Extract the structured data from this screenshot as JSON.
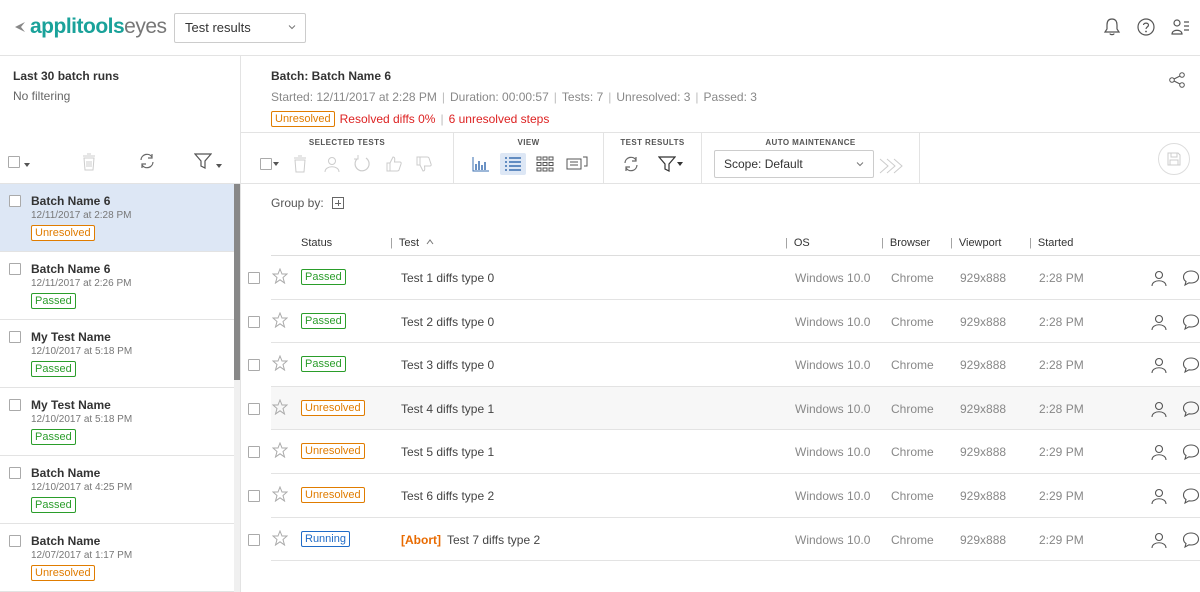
{
  "app": {
    "logo_brand": "applitools",
    "logo_suffix": "eyes",
    "view_select": "Test results"
  },
  "sidebar": {
    "title": "Last 30 batch runs",
    "filter_text": "No filtering",
    "batches": [
      {
        "name": "Batch Name 6",
        "date": "12/11/2017 at 2:28 PM",
        "status": "Unresolved",
        "status_key": "unresolved",
        "selected": true
      },
      {
        "name": "Batch Name 6",
        "date": "12/11/2017 at 2:26 PM",
        "status": "Passed",
        "status_key": "passed",
        "selected": false
      },
      {
        "name": "My Test Name",
        "date": "12/10/2017 at 5:18 PM",
        "status": "Passed",
        "status_key": "passed",
        "selected": false
      },
      {
        "name": "My Test Name",
        "date": "12/10/2017 at 5:18 PM",
        "status": "Passed",
        "status_key": "passed",
        "selected": false
      },
      {
        "name": "Batch Name",
        "date": "12/10/2017 at 4:25 PM",
        "status": "Passed",
        "status_key": "passed",
        "selected": false
      },
      {
        "name": "Batch Name",
        "date": "12/07/2017 at 1:17 PM",
        "status": "Unresolved",
        "status_key": "unresolved",
        "selected": false
      }
    ]
  },
  "batch": {
    "title": "Batch: Batch Name 6",
    "started": "Started: 12/11/2017 at 2:28 PM",
    "duration": "Duration: 00:00:57",
    "tests": "Tests: 7",
    "unresolved": "Unresolved: 3",
    "passed": "Passed: 3",
    "status_badge": "Unresolved",
    "resolved_diffs": "Resolved diffs 0%",
    "unresolved_steps": "6 unresolved steps"
  },
  "toolbar": {
    "selected_tests_label": "SELECTED TESTS",
    "view_label": "VIEW",
    "test_results_label": "TEST RESULTS",
    "auto_maintenance_label": "AUTO MAINTENANCE",
    "scope_value": "Scope: Default"
  },
  "groupby_label": "Group by:",
  "table": {
    "headers": {
      "status": "Status",
      "test": "Test",
      "os": "OS",
      "browser": "Browser",
      "viewport": "Viewport",
      "started": "Started"
    },
    "rows": [
      {
        "status": "Passed",
        "status_key": "passed",
        "abort": "",
        "test": "Test 1 diffs type 0",
        "os": "Windows 10.0",
        "browser": "Chrome",
        "viewport": "929x888",
        "started": "2:28 PM"
      },
      {
        "status": "Passed",
        "status_key": "passed",
        "abort": "",
        "test": "Test 2 diffs type 0",
        "os": "Windows 10.0",
        "browser": "Chrome",
        "viewport": "929x888",
        "started": "2:28 PM"
      },
      {
        "status": "Passed",
        "status_key": "passed",
        "abort": "",
        "test": "Test 3 diffs type 0",
        "os": "Windows 10.0",
        "browser": "Chrome",
        "viewport": "929x888",
        "started": "2:28 PM"
      },
      {
        "status": "Unresolved",
        "status_key": "unresolved",
        "abort": "",
        "test": "Test 4 diffs type 1",
        "os": "Windows 10.0",
        "browser": "Chrome",
        "viewport": "929x888",
        "started": "2:28 PM"
      },
      {
        "status": "Unresolved",
        "status_key": "unresolved",
        "abort": "",
        "test": "Test 5 diffs type 1",
        "os": "Windows 10.0",
        "browser": "Chrome",
        "viewport": "929x888",
        "started": "2:29 PM"
      },
      {
        "status": "Unresolved",
        "status_key": "unresolved",
        "abort": "",
        "test": "Test 6 diffs type 2",
        "os": "Windows 10.0",
        "browser": "Chrome",
        "viewport": "929x888",
        "started": "2:29 PM"
      },
      {
        "status": "Running",
        "status_key": "running",
        "abort": "[Abort]",
        "test": "Test 7 diffs type 2",
        "os": "Windows 10.0",
        "browser": "Chrome",
        "viewport": "929x888",
        "started": "2:29 PM"
      }
    ]
  },
  "colors": {
    "brand": "#1aa29a",
    "passed": "#2a9d2a",
    "unresolved": "#e07c00",
    "running": "#1f6bc7",
    "error": "#dd2222",
    "selected_bg": "#dde7f5"
  }
}
